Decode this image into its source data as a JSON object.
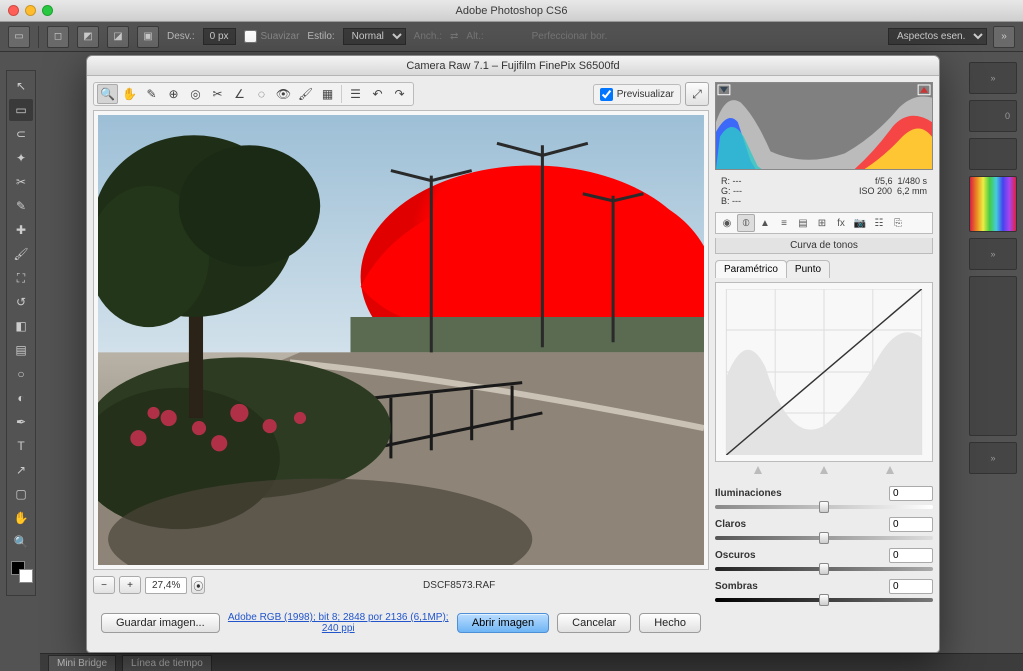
{
  "app": {
    "title": "Adobe Photoshop CS6"
  },
  "options": {
    "desv_label": "Desv.:",
    "desv_value": "0 px",
    "suavizar_label": "Suavizar",
    "estilo_label": "Estilo:",
    "estilo_value": "Normal",
    "anch_label": "Anch.:",
    "alt_label": "Alt.:",
    "perfeccionar_label": "Perfeccionar bor.",
    "workspace_label": "Aspectos esen."
  },
  "statusbar": {
    "tab1": "Mini Bridge",
    "tab2": "Línea de tiempo"
  },
  "dialog": {
    "title": "Camera Raw 7.1 – Fujifilm FinePix S6500fd",
    "preview_label": "Previsualizar",
    "zoom_value": "27,4%",
    "filename": "DSCF8573.RAF",
    "save_btn": "Guardar imagen...",
    "meta_link": "Adobe RGB (1998); bit 8; 2848 por 2136 (6,1MP); 240 ppi",
    "open_btn": "Abrir imagen",
    "cancel_btn": "Cancelar",
    "done_btn": "Hecho"
  },
  "info": {
    "r_label": "R:",
    "g_label": "G:",
    "b_label": "B:",
    "r_val": "---",
    "g_val": "---",
    "b_val": "---",
    "aperture": "f/5,6",
    "shutter": "1/480 s",
    "iso": "ISO 200",
    "focal": "6,2 mm"
  },
  "panel": {
    "section_title": "Curva de tonos",
    "tab_parametrico": "Paramétrico",
    "tab_punto": "Punto"
  },
  "sliders": {
    "iluminaciones_label": "Iluminaciones",
    "iluminaciones_val": "0",
    "claros_label": "Claros",
    "claros_val": "0",
    "oscuros_label": "Oscuros",
    "oscuros_val": "0",
    "sombras_label": "Sombras",
    "sombras_val": "0"
  },
  "right_panel_value": "0"
}
